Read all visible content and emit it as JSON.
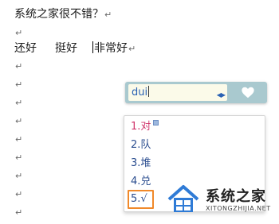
{
  "document": {
    "line1_text": "系统之家很不错？",
    "paragraph_mark": "↵",
    "line2_words": [
      "还好",
      "挺好",
      "非常好"
    ],
    "empty_marks": [
      "↵",
      "↵",
      "↵",
      "↵",
      "↵",
      "↵",
      "↵",
      "↵",
      "↵",
      "↵",
      "↵"
    ]
  },
  "ime": {
    "composition": "dui",
    "arrows": "◀▶",
    "heart_icon": "heart-icon",
    "candidates": [
      {
        "label": "1.对"
      },
      {
        "label": "2.队"
      },
      {
        "label": "3.堆"
      },
      {
        "label": "4.兑"
      },
      {
        "label": "5.√"
      }
    ],
    "selected_index": 4
  },
  "watermark": {
    "name": "系统之家",
    "url": "XITONGZHIJIA.NET"
  },
  "colors": {
    "ime_bar": "#a9c9cf",
    "ime_input_bg": "#fbfae9",
    "candidate_text": "#2a4d8f",
    "first_candidate": "#d0336a",
    "highlight_border": "#f0892a",
    "logo_blue": "#2f7bd6"
  }
}
